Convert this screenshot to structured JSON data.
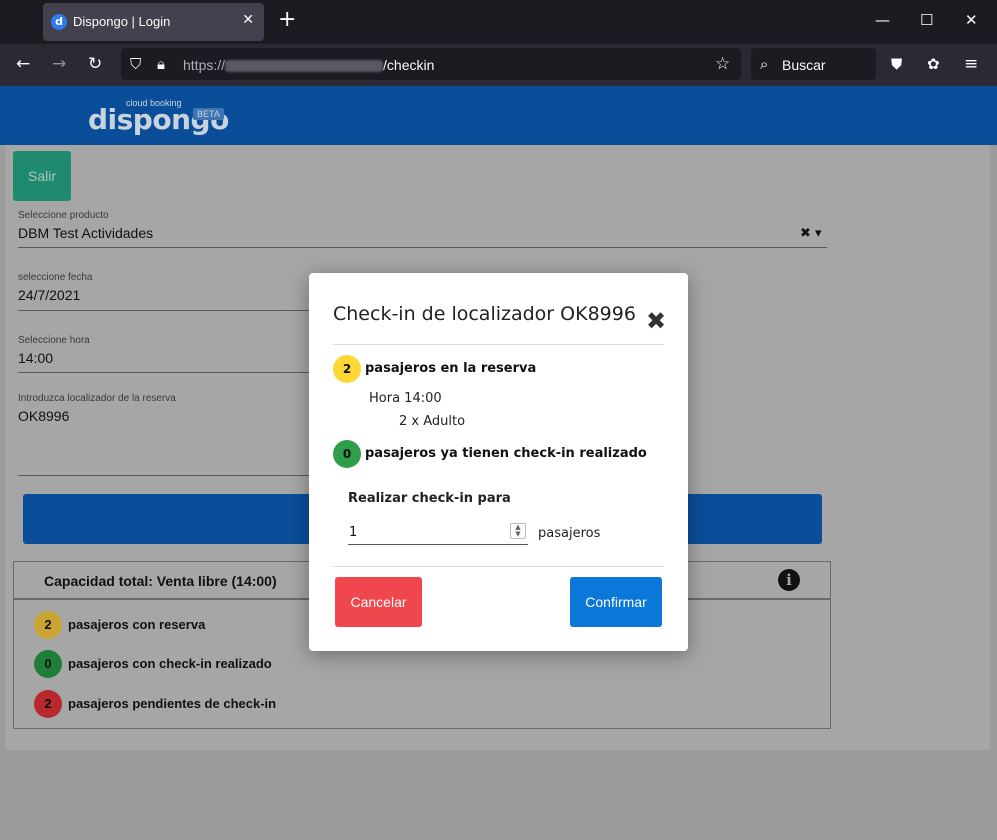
{
  "browser": {
    "tab_title": "Dispongo | Login",
    "tab_favicon": "d",
    "url_protocol": "https://",
    "url_path": "/checkin",
    "search_placeholder": "Buscar"
  },
  "brand": {
    "name": "dispongo",
    "tagline": "cloud booking",
    "badge": "BETA",
    "header_color": "#0a4e99"
  },
  "form": {
    "exit_label": "Salir",
    "product_label": "Seleccione producto",
    "product_value": "DBM Test Actividades",
    "date_label": "seleccione fecha",
    "date_value": "24/7/2021",
    "hour_label": "Seleccione hora",
    "hour_value": "14:00",
    "locator_label": "Introduzca localizador de la reserva",
    "locator_value": "OK8996"
  },
  "capacity": {
    "title": "Capacidad total:  Venta libre (14:00)",
    "rows": [
      {
        "count": "2",
        "text": "pasajeros con reserva",
        "color": "#c9a432"
      },
      {
        "count": "0",
        "text": "pasajeros con check-in realizado",
        "color": "#1f7f3a"
      },
      {
        "count": "2",
        "text": "pasajeros pendientes de check-in",
        "color": "#b8282e"
      }
    ]
  },
  "modal": {
    "title": "Check-in de localizador  OK8996",
    "booked_count": "2",
    "booked_text": "pasajeros en la reserva",
    "hour_text": "Hora 14:00",
    "pax_text": "2 x Adulto",
    "checked_count": "0",
    "checked_text": "pasajeros ya tienen check-in realizado",
    "checkin_label": "Realizar check-in para",
    "checkin_value": "1",
    "checkin_unit": "pasajeros",
    "cancel_label": "Cancelar",
    "confirm_label": "Confirmar",
    "colors": {
      "yellow": "#fdd835",
      "green": "#2e9e4a",
      "cancel": "#f0474e",
      "confirm": "#0b77d8"
    }
  }
}
